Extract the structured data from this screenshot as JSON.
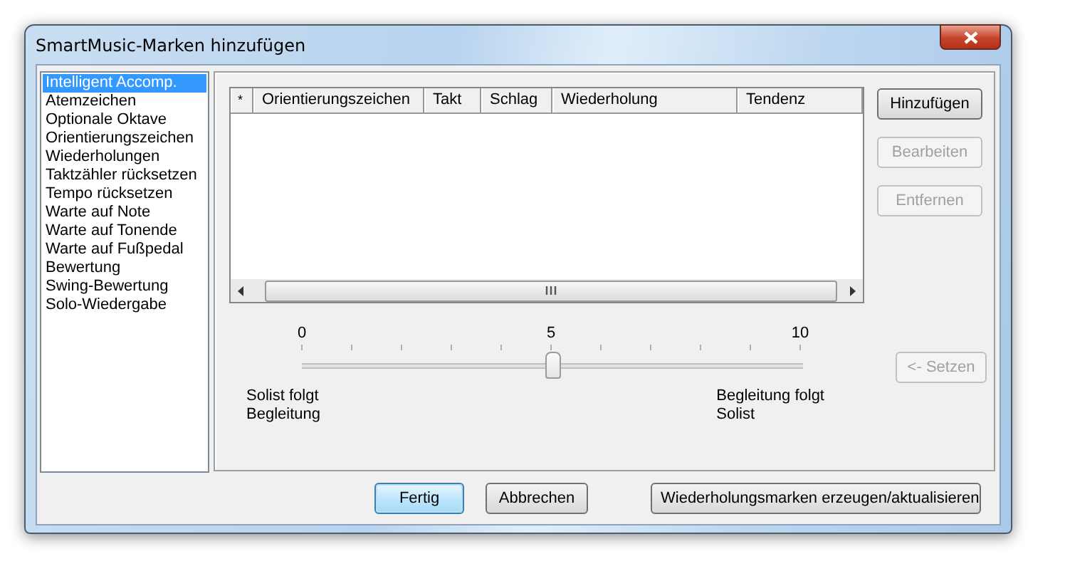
{
  "window": {
    "title": "SmartMusic-Marken hinzufügen"
  },
  "marker_list": {
    "items": [
      {
        "label": "Intelligent Accomp.",
        "selected": true
      },
      {
        "label": "Atemzeichen",
        "selected": false
      },
      {
        "label": "Optionale Oktave",
        "selected": false
      },
      {
        "label": "Orientierungszeichen",
        "selected": false
      },
      {
        "label": "Wiederholungen",
        "selected": false
      },
      {
        "label": "Taktzähler rücksetzen",
        "selected": false
      },
      {
        "label": "Tempo rücksetzen",
        "selected": false
      },
      {
        "label": "Warte auf Note",
        "selected": false
      },
      {
        "label": "Warte auf Tonende",
        "selected": false
      },
      {
        "label": "Warte auf Fußpedal",
        "selected": false
      },
      {
        "label": "Bewertung",
        "selected": false
      },
      {
        "label": "Swing-Bewertung",
        "selected": false
      },
      {
        "label": "Solo-Wiedergabe",
        "selected": false
      }
    ]
  },
  "table": {
    "columns": [
      "*",
      "Orientierungszeichen",
      "Takt",
      "Schlag",
      "Wiederholung",
      "Tendenz"
    ]
  },
  "side_buttons": [
    {
      "label": "Hinzufügen",
      "disabled": false
    },
    {
      "label": "Bearbeiten",
      "disabled": true
    },
    {
      "label": "Entfernen",
      "disabled": true
    }
  ],
  "slider": {
    "tick_labels": [
      "0",
      "5",
      "10"
    ],
    "level": 0.5,
    "left_label": "Solist folgt\nBegleitung",
    "right_label": "Begleitung folgt\nSolist"
  },
  "set_button": {
    "label": "<- Setzen",
    "disabled": true
  },
  "footer_buttons": [
    {
      "label": "Fertig",
      "default": true
    },
    {
      "label": "Abbrechen",
      "default": false
    },
    {
      "label": "Wiederholungsmarken erzeugen/aktualisieren",
      "default": false
    }
  ]
}
